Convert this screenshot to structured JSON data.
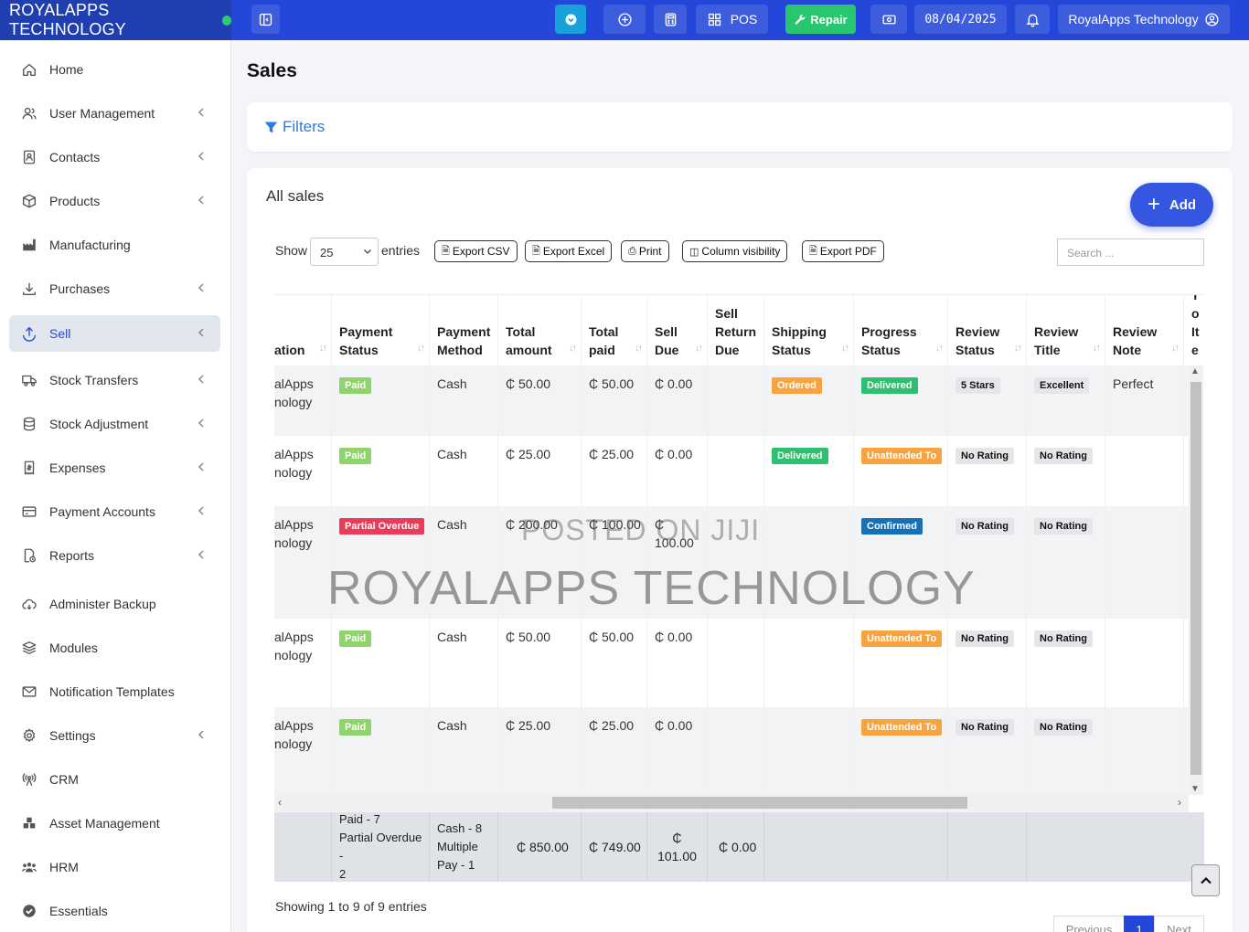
{
  "brand": {
    "name": "ROYALAPPS TECHNOLOGY",
    "status_color": "#2ecc71"
  },
  "topbar": {
    "pos_label": "POS",
    "repair_label": "Repair",
    "date": "08/04/2025",
    "user_label": "RoyalApps Technology",
    "colors": {
      "bar": "#2447d9",
      "repair": "#28c76f"
    }
  },
  "sidebar": {
    "items": [
      {
        "label": "Home",
        "icon": "home-icon"
      },
      {
        "label": "User Management",
        "icon": "users-icon"
      },
      {
        "label": "Contacts",
        "icon": "contacts-icon"
      },
      {
        "label": "Products",
        "icon": "cube-icon"
      },
      {
        "label": "Manufacturing",
        "icon": "industry-icon"
      },
      {
        "label": "Purchases",
        "icon": "download-icon"
      },
      {
        "label": "Sell",
        "icon": "upload-icon"
      },
      {
        "label": "Stock Transfers",
        "icon": "truck-icon"
      },
      {
        "label": "Stock Adjustment",
        "icon": "database-icon"
      },
      {
        "label": "Expenses",
        "icon": "receipt-icon"
      },
      {
        "label": "Payment Accounts",
        "icon": "card-icon"
      },
      {
        "label": "Reports",
        "icon": "report-icon"
      },
      {
        "label": "Administer Backup",
        "icon": "cloud-icon"
      },
      {
        "label": "Modules",
        "icon": "layers-icon"
      },
      {
        "label": "Notification Templates",
        "icon": "envelope-icon"
      },
      {
        "label": "Settings",
        "icon": "gear-icon"
      },
      {
        "label": "CRM",
        "icon": "broadcast-icon"
      },
      {
        "label": "Asset Management",
        "icon": "boxes-icon"
      },
      {
        "label": "HRM",
        "icon": "team-icon"
      },
      {
        "label": "Essentials",
        "icon": "check-circle-icon"
      }
    ]
  },
  "main": {
    "title": "Sales",
    "filters_label": "Filters",
    "card_title": "All sales",
    "add_label": "Add",
    "show_label": "Show",
    "page_length": "25",
    "entries_label": "entries",
    "buttons": {
      "csv": "Export CSV",
      "excel": "Export Excel",
      "print": "Print",
      "colvis": "Column visibility",
      "pdf": "Export PDF"
    },
    "search_placeholder": "Search ...",
    "showing": "Showing 1 to 9 of 9 entries",
    "pager": {
      "prev": "Previous",
      "page": "1",
      "next": "Next"
    }
  },
  "table": {
    "headers": {
      "location": "ation",
      "payment_status": "Payment Status",
      "payment_method": "Payment Method",
      "total_amount": "Total amount",
      "total_paid": "Total paid",
      "sell_due": "Sell Due",
      "sell_return_due": "Sell Return Due",
      "shipping_status": "Shipping Status",
      "progress_status": "Progress Status",
      "review_status": "Review Status",
      "review_title": "Review Title",
      "review_note": "Review Note",
      "total_items": "To Ite"
    },
    "rows": [
      {
        "loc1": "alApps",
        "loc2": "nology",
        "pay": "Paid",
        "method": "Cash",
        "amount": "₵ 50.00",
        "paid": "₵ 50.00",
        "due": "₵ 0.00",
        "ship": "Ordered",
        "progress": "Delivered",
        "rstatus": "5 Stars",
        "rtitle": "Excellent",
        "rnote": "Perfect"
      },
      {
        "loc1": "alApps",
        "loc2": "nology",
        "pay": "Paid",
        "method": "Cash",
        "amount": "₵ 25.00",
        "paid": "₵ 25.00",
        "due": "₵ 0.00",
        "ship": "Delivered",
        "progress": "Unattended To",
        "rstatus": "No Rating",
        "rtitle": "No Rating",
        "rnote": ""
      },
      {
        "loc1": "alApps",
        "loc2": "nology",
        "pay": "Partial Overdue",
        "method": "Cash",
        "amount": "₵ 200.00",
        "paid": "₵ 100.00",
        "due": "₵",
        "due2": "100.00",
        "ship": "",
        "progress": "Confirmed",
        "rstatus": "No Rating",
        "rtitle": "No Rating",
        "rnote": ""
      },
      {
        "loc1": "alApps",
        "loc2": "nology",
        "pay": "Paid",
        "method": "Cash",
        "amount": "₵ 50.00",
        "paid": "₵ 50.00",
        "due": "₵ 0.00",
        "ship": "",
        "progress": "Unattended To",
        "rstatus": "No Rating",
        "rtitle": "No Rating",
        "rnote": ""
      },
      {
        "loc1": "alApps",
        "loc2": "nology",
        "pay": "Paid",
        "method": "Cash",
        "amount": "₵ 25.00",
        "paid": "₵ 25.00",
        "due": "₵ 0.00",
        "ship": "",
        "progress": "Unattended To",
        "rstatus": "No Rating",
        "rtitle": "No Rating",
        "rnote": ""
      }
    ],
    "footer": {
      "pay1": "Paid - 7",
      "pay2": "Partial Overdue -",
      "pay3": "2",
      "meth1": "Cash - 8",
      "meth2": "Multiple",
      "meth3": "Pay - 1",
      "amount": "₵ 850.00",
      "paid": "₵ 749.00",
      "due1": "₵",
      "due2": "101.00",
      "ret": "₵ 0.00"
    }
  },
  "watermarks": {
    "small": "POSTED ON JIJI",
    "large": "ROYALAPPS TECHNOLOGY"
  }
}
